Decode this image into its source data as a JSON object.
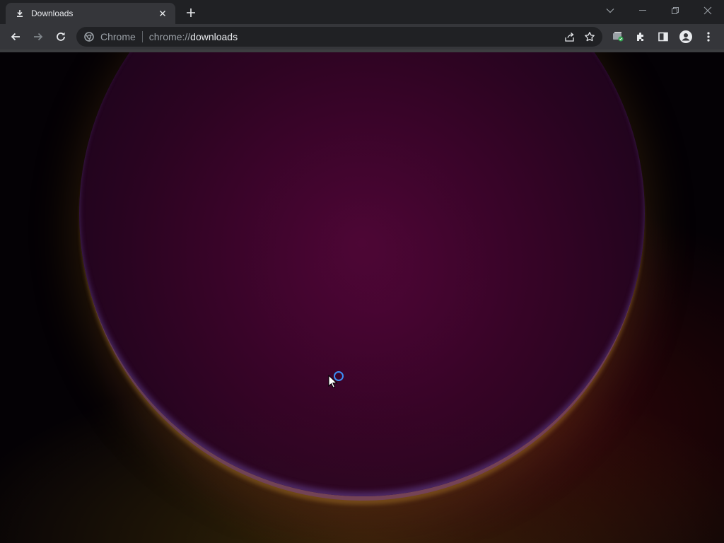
{
  "tab": {
    "title": "Downloads",
    "favicon": "download-icon",
    "close_icon": "close-icon"
  },
  "new_tab_icon": "plus-icon",
  "window_controls": [
    "tab-search-icon",
    "minimize-icon",
    "restore-icon",
    "close-window-icon"
  ],
  "toolbar": {
    "back_icon": "back-arrow-icon",
    "forward_icon": "forward-arrow-icon",
    "reload_icon": "reload-icon"
  },
  "omnibox": {
    "chip_label": "Chrome",
    "chip_icon": "chrome-logo-icon",
    "url_scheme": "chrome://",
    "url_host": "downloads",
    "actions": [
      "share-icon",
      "bookmark-star-icon"
    ]
  },
  "extensions": [
    "shopping-extension-icon",
    "puzzle-extensions-icon",
    "side-panel-icon",
    "profile-avatar-icon",
    "more-menu-icon"
  ],
  "colors": {
    "accent_blue": "#3b8ef5",
    "tab_bg": "#35363a",
    "frame_bg": "#202124"
  }
}
